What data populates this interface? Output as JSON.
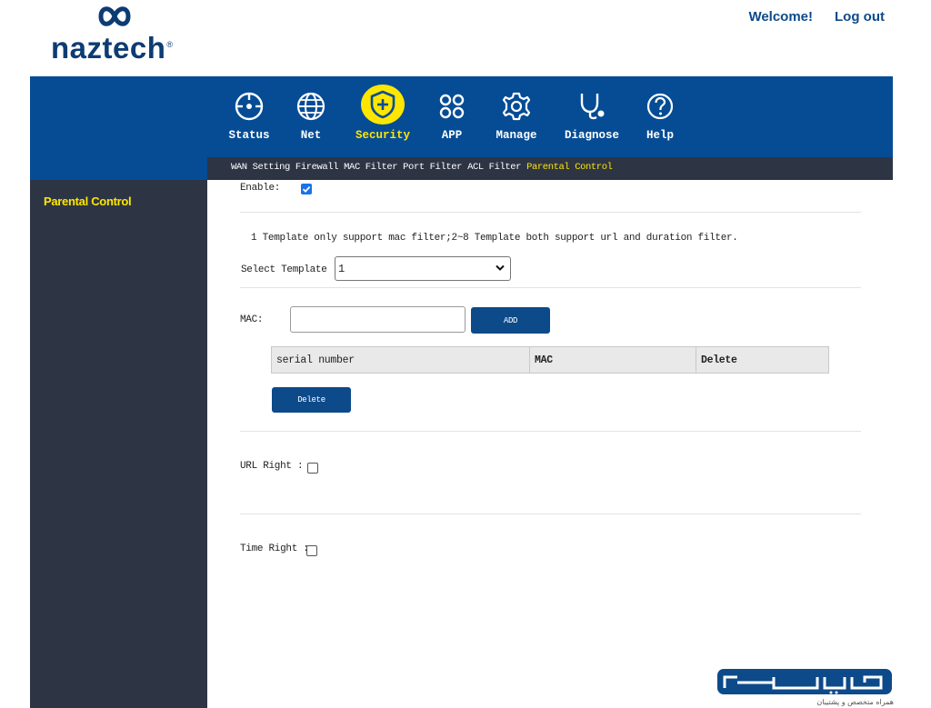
{
  "brand": {
    "name": "naztech",
    "mark": "®"
  },
  "header": {
    "welcome_label": "Welcome!",
    "logout_label": "Log out"
  },
  "nav": {
    "items": [
      {
        "label": "Status",
        "icon": "status-icon"
      },
      {
        "label": "Net",
        "icon": "globe-icon"
      },
      {
        "label": "Security",
        "icon": "shield-plus-icon",
        "active": true
      },
      {
        "label": "APP",
        "icon": "apps-icon"
      },
      {
        "label": "Manage",
        "icon": "gear-icon"
      },
      {
        "label": "Diagnose",
        "icon": "stethoscope-icon"
      },
      {
        "label": "Help",
        "icon": "help-icon"
      }
    ]
  },
  "subnav": {
    "items": [
      "WAN Setting",
      "Firewall",
      "MAC Filter",
      "Port Filter",
      "ACL Filter",
      "Parental Control"
    ],
    "active": "Parental Control"
  },
  "sidebar": {
    "items": [
      {
        "label": "Parental Control",
        "active": true
      }
    ]
  },
  "form": {
    "enable_label": "Enable:",
    "enable_checked": true,
    "note": "1 Template only support mac filter;2~8 Template both support url and duration filter.",
    "template_label": "Select Template :",
    "template_value": "1",
    "mac_label": "MAC:",
    "mac_value": "",
    "add_label": "ADD",
    "table_headers": [
      "serial number",
      "MAC",
      "Delete"
    ],
    "delete_label": "Delete",
    "url_right_label": "URL Right :",
    "url_right_checked": false,
    "time_right_label": "Time Right :",
    "time_right_checked": false
  },
  "watermark": {
    "tagline": "همراه متخصص و پشتیبان"
  },
  "colors": {
    "nav_bg": "#054c95",
    "sidebar_bg": "#2d3545",
    "accent": "#ffe600",
    "button": "#0d4a8a",
    "logo_text": "#0d3c73"
  }
}
